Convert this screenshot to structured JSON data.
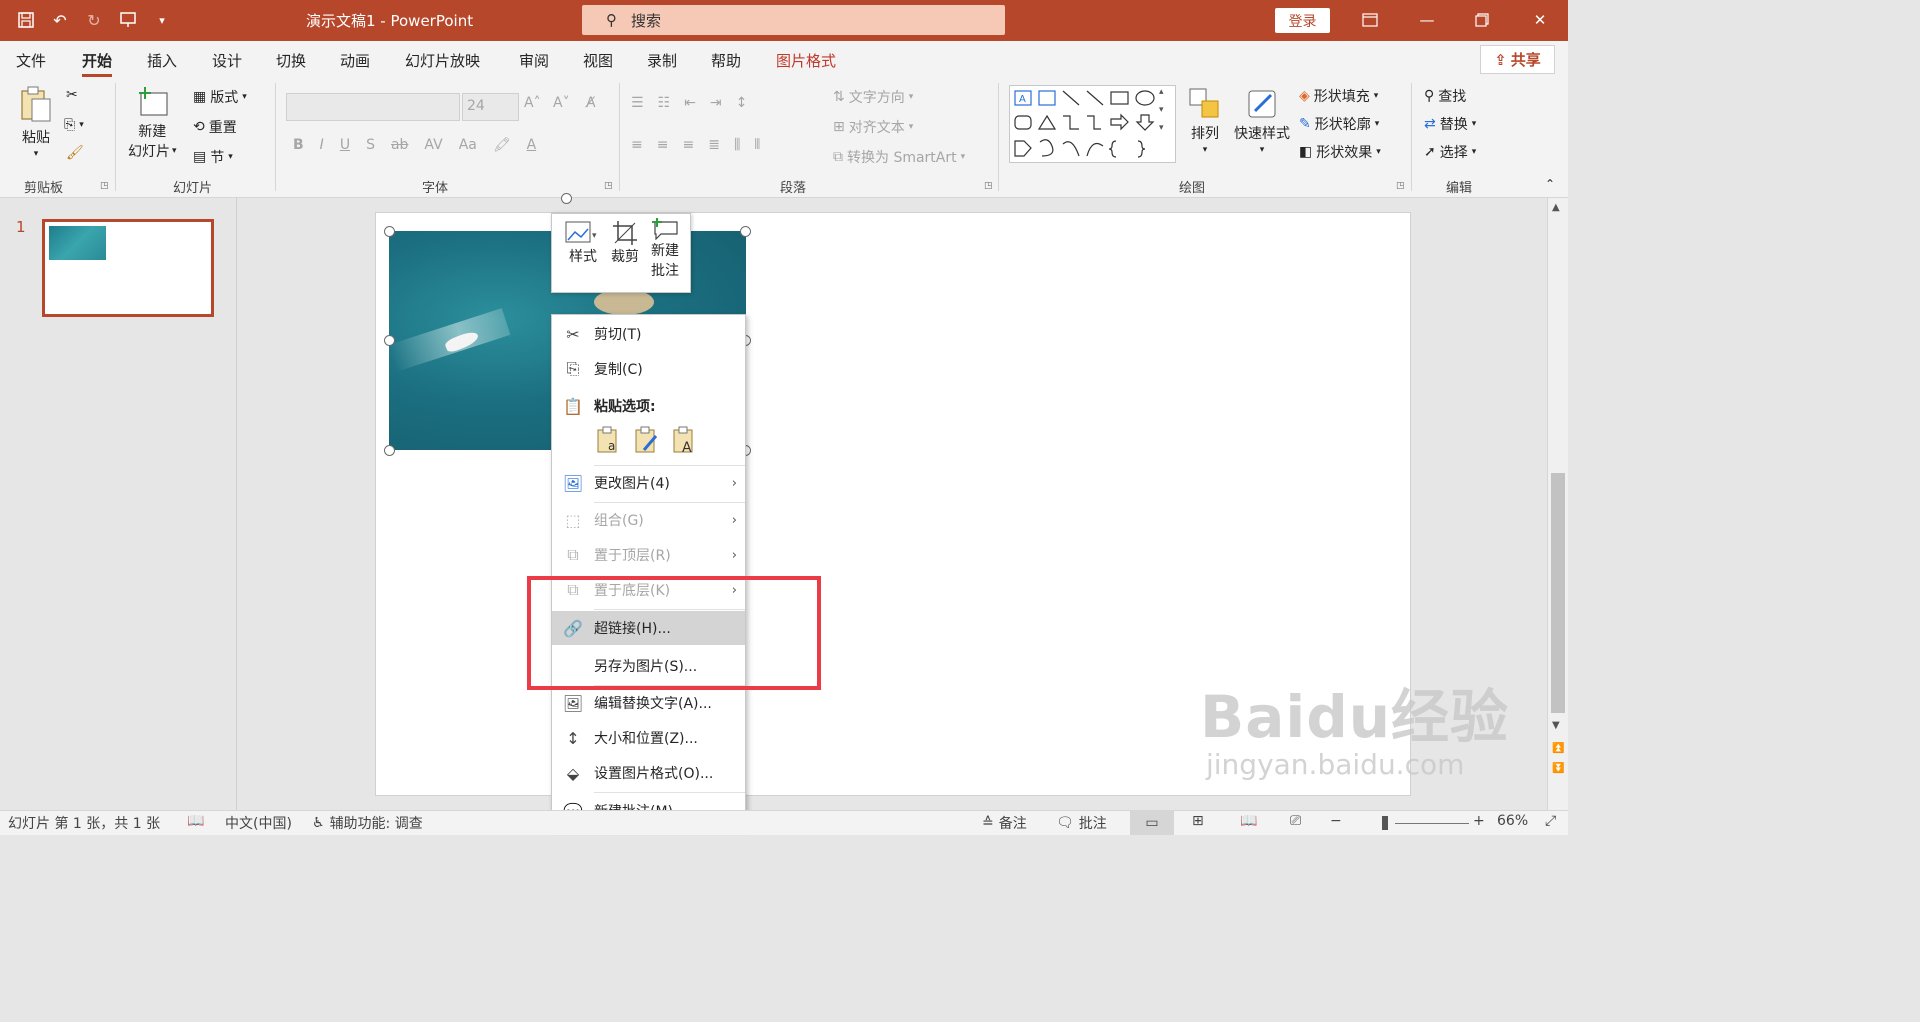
{
  "colors": {
    "brand": "#b7472a",
    "highlight_box": "#ea3b46",
    "menu_hover": "#d4d4d4",
    "disabled_text": "#a6a6a6"
  },
  "titlebar": {
    "title": "演示文稿1  -  PowerPoint",
    "search_placeholder": "搜索",
    "login_label": "登录",
    "icons": [
      "save-icon",
      "undo-icon",
      "redo-icon",
      "present-icon",
      "customize-qat-icon",
      "search-icon",
      "ribbon-display-icon",
      "minimize-icon",
      "restore-icon",
      "close-icon"
    ]
  },
  "tabs": [
    {
      "label": "文件"
    },
    {
      "label": "开始",
      "active": true
    },
    {
      "label": "插入"
    },
    {
      "label": "设计"
    },
    {
      "label": "切换"
    },
    {
      "label": "动画"
    },
    {
      "label": "幻灯片放映"
    },
    {
      "label": "审阅"
    },
    {
      "label": "视图"
    },
    {
      "label": "录制"
    },
    {
      "label": "帮助"
    },
    {
      "label": "图片格式"
    }
  ],
  "share_label": "共享",
  "ribbon": {
    "clipboard": {
      "paste": "粘贴",
      "group": "剪贴板"
    },
    "slides": {
      "new_slide_1": "新建",
      "new_slide_2": "幻灯片",
      "layout": "版式",
      "reset": "重置",
      "section": "节",
      "group": "幻灯片"
    },
    "font": {
      "size": "24",
      "group": "字体"
    },
    "paragraph": {
      "text_direction": "文字方向",
      "align_text": "对齐文本",
      "convert_smartart": "转换为 SmartArt",
      "group": "段落"
    },
    "drawing": {
      "arrange": "排列",
      "quick_styles": "快速样式",
      "shape_fill": "形状填充",
      "shape_outline": "形状轮廓",
      "shape_effects": "形状效果",
      "group": "绘图"
    },
    "editing": {
      "find": "查找",
      "replace": "替换",
      "select": "选择",
      "group": "编辑"
    }
  },
  "slide_panel": {
    "slide_number": "1"
  },
  "mini_toolbar": {
    "style": "样式",
    "crop": "裁剪",
    "new_comment_1": "新建",
    "new_comment_2": "批注"
  },
  "context_menu": {
    "cut": "剪切(T)",
    "copy": "复制(C)",
    "paste_options": "粘贴选项:",
    "change_picture": "更改图片(4)",
    "group": "组合(G)",
    "bring_to_front": "置于顶层(R)",
    "send_to_back": "置于底层(K)",
    "hyperlink": "超链接(H)...",
    "save_as_picture": "另存为图片(S)...",
    "edit_alt_text": "编辑替换文字(A)...",
    "size_and_position": "大小和位置(Z)...",
    "format_picture": "设置图片格式(O)...",
    "new_comment": "新建批注(M)"
  },
  "statusbar": {
    "slide_info": "幻灯片 第 1 张，共 1 张",
    "language": "中文(中国)",
    "accessibility": "辅助功能: 调查",
    "notes": "备注",
    "comments": "批注",
    "zoom": "66%"
  },
  "watermark": {
    "line1": "Baidu经验",
    "line2": "jingyan.baidu.com"
  }
}
